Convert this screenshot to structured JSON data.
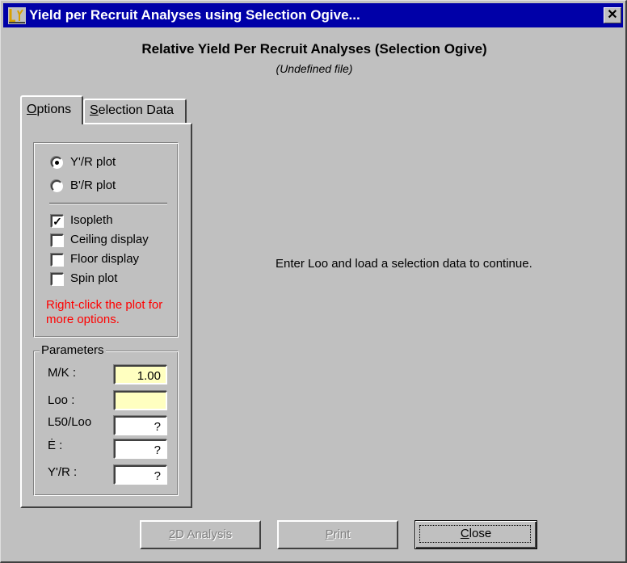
{
  "window": {
    "title": "Yield per Recruit Analyses using Selection Ogive...",
    "close_glyph": "✕"
  },
  "header": {
    "title": "Relative Yield Per Recruit Analyses (Selection Ogive)",
    "subtitle": "(Undefined file)"
  },
  "tabs": [
    {
      "label_mnemonic": "O",
      "label_rest": "ptions",
      "active": true
    },
    {
      "label_mnemonic": "S",
      "label_rest": "election Data",
      "active": false
    }
  ],
  "options": {
    "radios": [
      {
        "label": "Y'/R plot",
        "checked": true
      },
      {
        "label": "B'/R plot",
        "checked": false
      }
    ],
    "checkboxes": [
      {
        "label": "Isopleth",
        "checked": true,
        "mark": "✓"
      },
      {
        "label": "Ceiling display",
        "checked": false,
        "mark": ""
      },
      {
        "label": "Floor display",
        "checked": false,
        "mark": ""
      },
      {
        "label": "Spin plot",
        "checked": false,
        "mark": ""
      }
    ],
    "hint": "Right-click the plot for more options.",
    "hint_color": "#ff0000"
  },
  "parameters": {
    "legend": "Parameters",
    "rows": [
      {
        "label": "M/K :",
        "value": "1.00"
      },
      {
        "label": "Loo :",
        "value": ""
      },
      {
        "label": "L50/Loo",
        "value": "?"
      },
      {
        "label": "Ė :",
        "value": "?"
      },
      {
        "label": "Y'/R :",
        "value": "?"
      }
    ]
  },
  "message": "Enter Loo and load a selection data to continue.",
  "buttons": {
    "analysis_2d_mnemonic": "2",
    "analysis_2d_rest": "D Analysis",
    "print_mnemonic": "P",
    "print_rest": "rint",
    "close_mnemonic": "C",
    "close_rest": "lose"
  },
  "colors": {
    "titlebar": "#0000a8",
    "dialog_bg": "#c0c0c0",
    "highlight_field": "#ffffc0"
  }
}
